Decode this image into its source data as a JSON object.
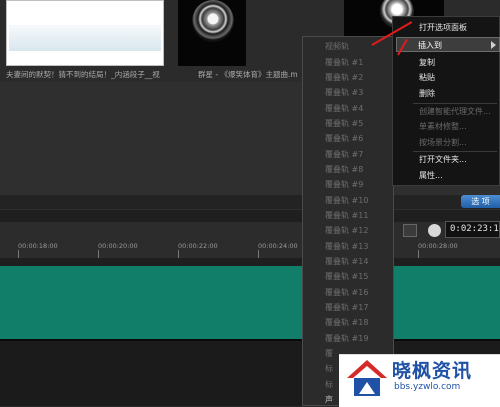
{
  "library": {
    "captions": [
      "夫妻间的默契！猜不到的结局！_内涵段子__视",
      "群星 - 《爆笑体育》主题曲.m",
      ""
    ]
  },
  "options_tab": {
    "label": "选 项"
  },
  "timeline": {
    "ruler_labels": [
      "00:00:18:00",
      "00:00:20:00",
      "00:00:22:00",
      "00:00:24:00",
      "00:00:28:00"
    ],
    "timecode": "0:02:23:19"
  },
  "submenu": {
    "items": [
      {
        "label": "视频轨",
        "enabled": false
      },
      {
        "label": "覆叠轨 #1",
        "enabled": false
      },
      {
        "label": "覆叠轨 #2",
        "enabled": false
      },
      {
        "label": "覆叠轨 #3",
        "enabled": false
      },
      {
        "label": "覆叠轨 #4",
        "enabled": false
      },
      {
        "label": "覆叠轨 #5",
        "enabled": false
      },
      {
        "label": "覆叠轨 #6",
        "enabled": false
      },
      {
        "label": "覆叠轨 #7",
        "enabled": false
      },
      {
        "label": "覆叠轨 #8",
        "enabled": false
      },
      {
        "label": "覆叠轨 #9",
        "enabled": false
      },
      {
        "label": "覆叠轨 #10",
        "enabled": false
      },
      {
        "label": "覆叠轨 #11",
        "enabled": false
      },
      {
        "label": "覆叠轨 #12",
        "enabled": false
      },
      {
        "label": "覆叠轨 #13",
        "enabled": false
      },
      {
        "label": "覆叠轨 #14",
        "enabled": false
      },
      {
        "label": "覆叠轨 #15",
        "enabled": false
      },
      {
        "label": "覆叠轨 #16",
        "enabled": false
      },
      {
        "label": "覆叠轨 #17",
        "enabled": false
      },
      {
        "label": "覆叠轨 #18",
        "enabled": false
      },
      {
        "label": "覆叠轨 #19",
        "enabled": false
      },
      {
        "label": "覆",
        "enabled": false
      },
      {
        "label": "标",
        "enabled": false
      },
      {
        "label": "标",
        "enabled": false
      },
      {
        "label": "声",
        "enabled": true
      }
    ]
  },
  "context_menu": {
    "open_panel": "打开选项面板",
    "insert_to": "插入到",
    "copy": "复制",
    "paste": "粘贴",
    "delete": "删除",
    "create_proxy": "创建智能代理文件...",
    "single_trim": "单素材修整...",
    "split_by_scene": "按场景分割...",
    "open_folder": "打开文件夹...",
    "properties": "属性..."
  },
  "watermark": {
    "title": "晓枫资讯",
    "url": "bbs.yzwlo.com"
  },
  "colors": {
    "timeline_track": "#117e6a",
    "annotation_red": "#e21b1b",
    "watermark_blue": "#1f52a6"
  }
}
